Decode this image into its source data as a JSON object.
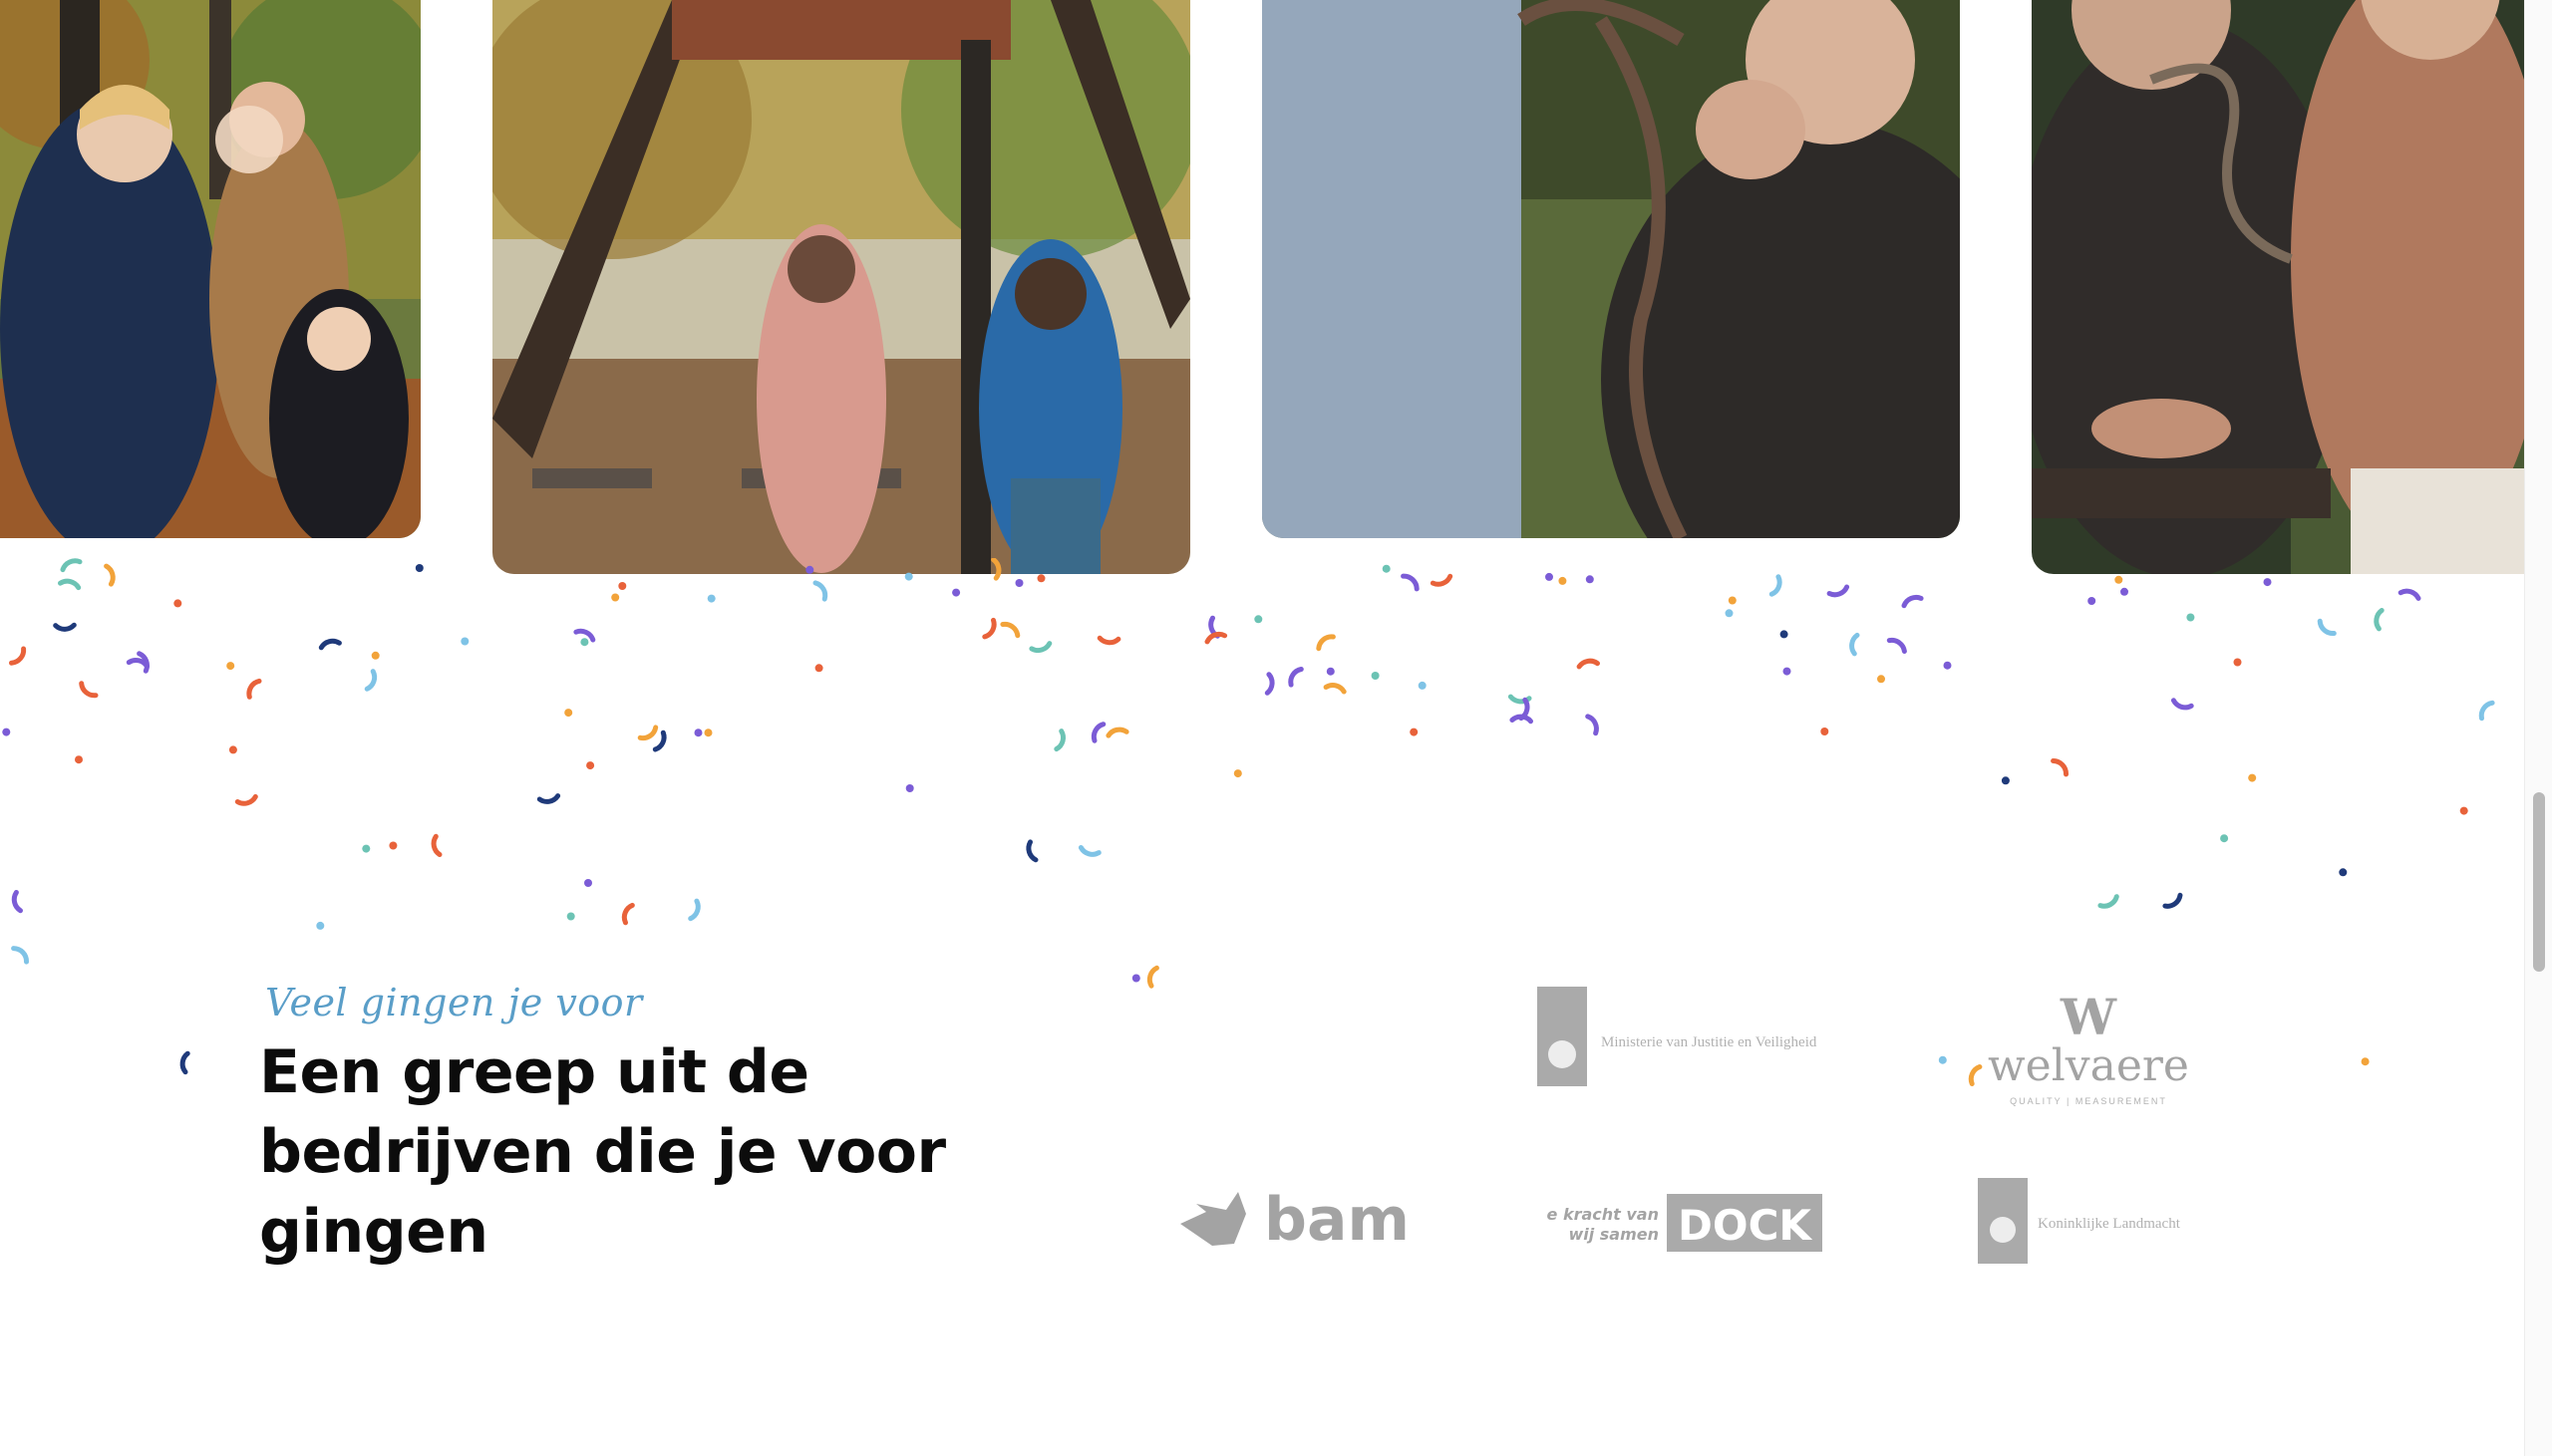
{
  "gallery": {
    "photos": [
      {
        "icon": "photo-family-playground"
      },
      {
        "icon": "photo-children-playground"
      },
      {
        "icon": "photo-men-metalwork"
      },
      {
        "icon": "photo-couple-workshop"
      }
    ]
  },
  "companies": {
    "eyebrow": "Veel gingen je voor",
    "title": "Een greep uit de bedrijven die je voor gingen",
    "logos": {
      "ministerie": "Ministerie van Justitie en Veiligheid",
      "welvaere_mark": "W",
      "welvaere_name": "welvaere",
      "welvaere_sub": "QUALITY | MEASUREMENT",
      "bam": "bam",
      "dock_tagline_1": "De kracht van",
      "dock_tagline_2": "wij samen",
      "dock": "DOCK",
      "landmacht": "Koninklijke Landmacht"
    }
  },
  "colors": {
    "confetti": [
      "#f2a33a",
      "#e8623a",
      "#7b5cd6",
      "#1f3a7a",
      "#6cc3b4",
      "#7fc3e6"
    ],
    "eyebrow": "#5a9ec8",
    "title": "#0c0c0c"
  }
}
